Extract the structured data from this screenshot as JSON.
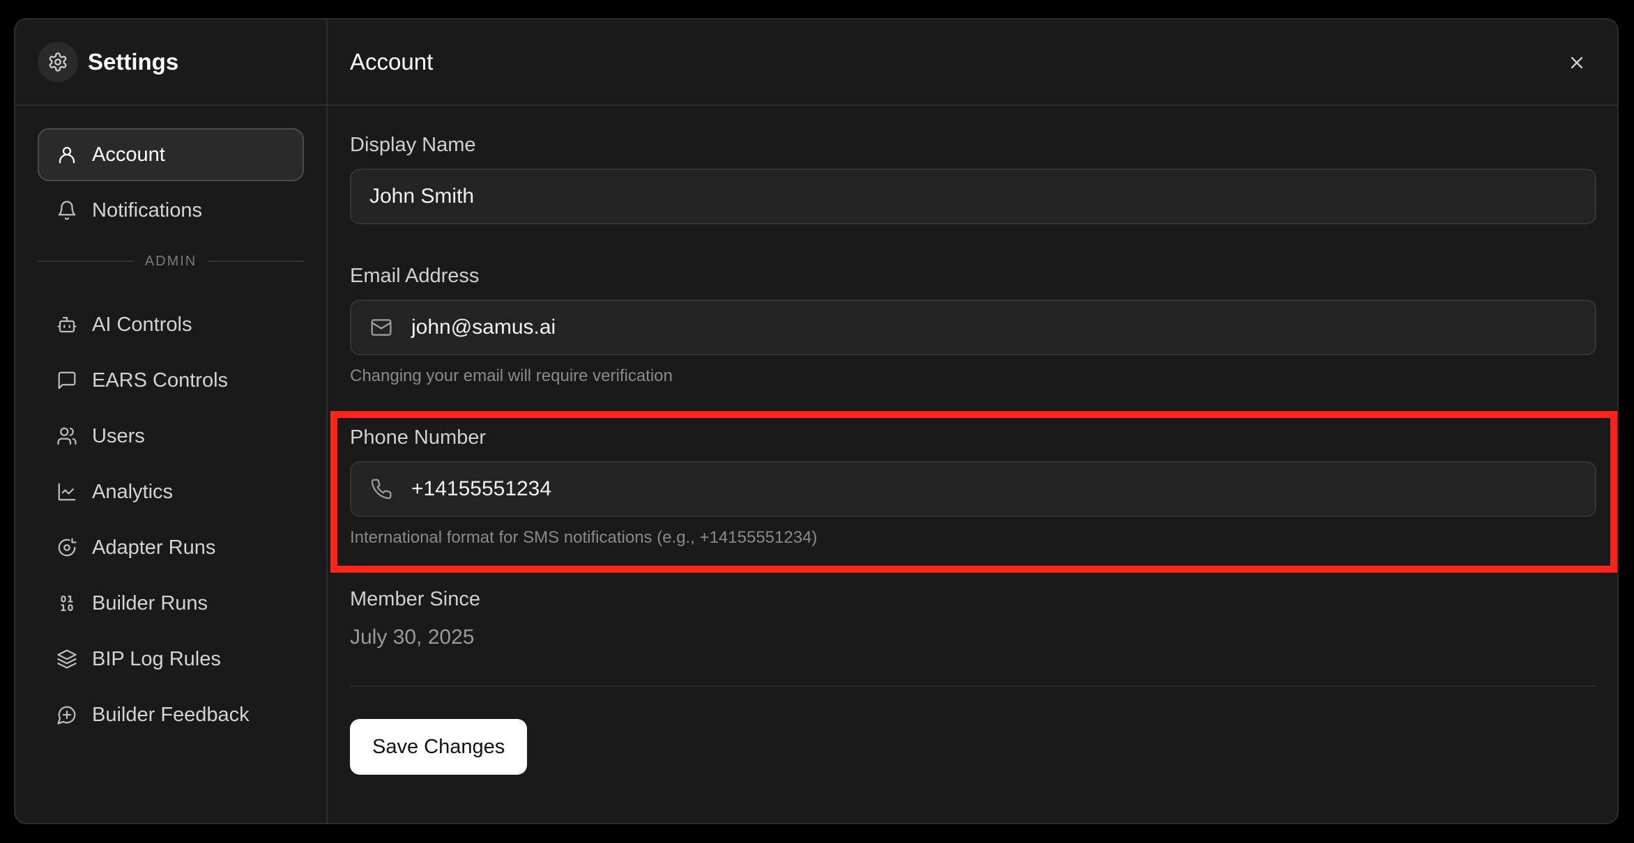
{
  "sidebar": {
    "title": "Settings",
    "primary_items": [
      {
        "label": "Account",
        "icon": "user-icon",
        "active": true
      },
      {
        "label": "Notifications",
        "icon": "bell-icon",
        "active": false
      }
    ],
    "section_label": "ADMIN",
    "admin_items": [
      {
        "label": "AI Controls",
        "icon": "bot-icon"
      },
      {
        "label": "EARS Controls",
        "icon": "message-square-icon"
      },
      {
        "label": "Users",
        "icon": "users-icon"
      },
      {
        "label": "Analytics",
        "icon": "line-chart-icon"
      },
      {
        "label": "Adapter Runs",
        "icon": "disc-icon"
      },
      {
        "label": "Builder Runs",
        "icon": "binary-icon"
      },
      {
        "label": "BIP Log Rules",
        "icon": "layers-icon"
      },
      {
        "label": "Builder Feedback",
        "icon": "message-plus-icon"
      }
    ]
  },
  "main": {
    "title": "Account",
    "display_name": {
      "label": "Display Name",
      "value": "John Smith"
    },
    "email": {
      "label": "Email Address",
      "value": "john@samus.ai",
      "hint": "Changing your email will require verification"
    },
    "phone": {
      "label": "Phone Number",
      "value": "+14155551234",
      "hint": "International format for SMS notifications (e.g., +14155551234)"
    },
    "member_since": {
      "label": "Member Since",
      "value": "July 30, 2025"
    },
    "save_label": "Save Changes"
  },
  "colors": {
    "highlight": "#ff2418",
    "background": "#1a1a1a",
    "button": "#ffffff"
  }
}
